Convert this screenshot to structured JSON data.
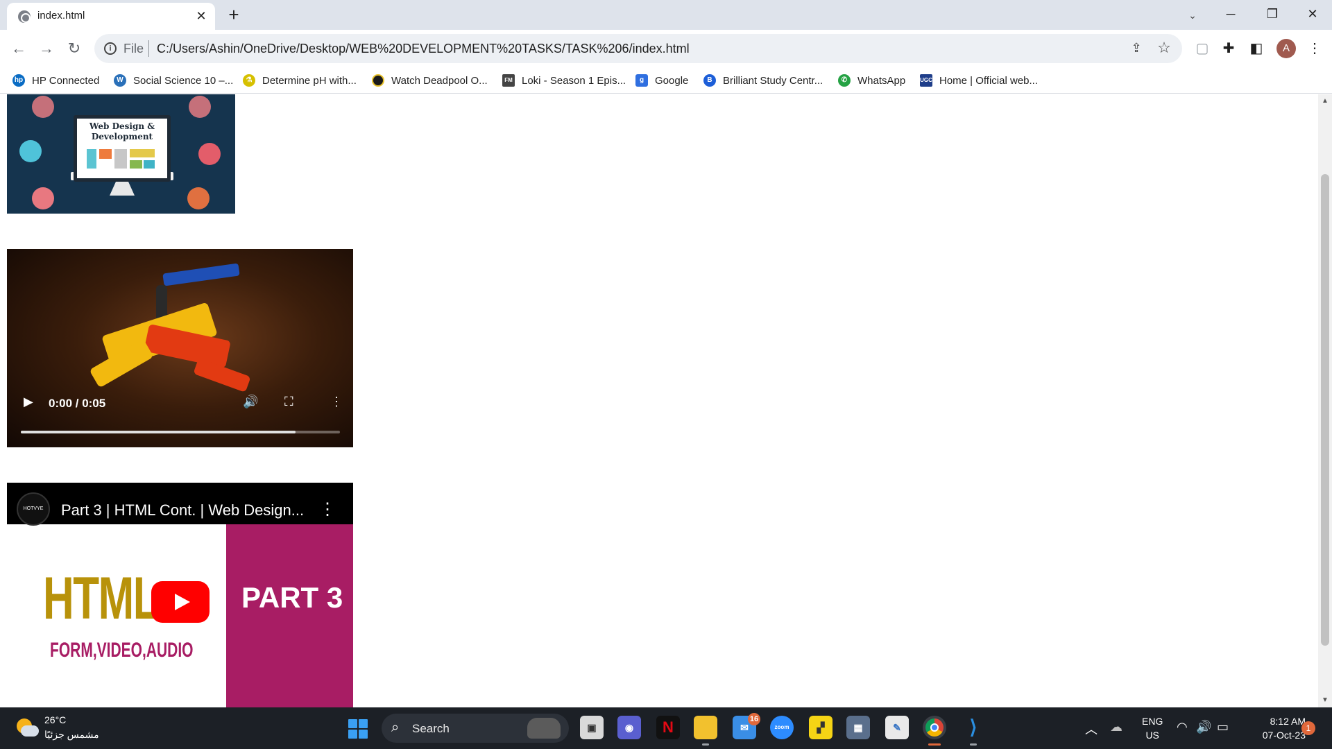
{
  "tab": {
    "title": "index.html",
    "close": "✕",
    "new": "+"
  },
  "window": {
    "minimize": "─",
    "restore": "❐",
    "close": "✕",
    "search": "⌄"
  },
  "nav": {
    "back": "←",
    "forward": "→",
    "reload": "↻"
  },
  "omnibox": {
    "scheme": "File",
    "url": "C:/Users/Ashin/OneDrive/Desktop/WEB%20DEVELOPMENT%20TASKS/TASK%206/index.html"
  },
  "profile": {
    "initial": "A"
  },
  "bookmarks": [
    {
      "label": "HP Connected",
      "icon": "hp-icon",
      "color": "#0a6cc4"
    },
    {
      "label": "Social Science 10 –...",
      "icon": "wordpress-icon",
      "color": "#2a70b9"
    },
    {
      "label": "Determine pH with...",
      "icon": "flask-icon",
      "color": "#d6c000"
    },
    {
      "label": "Watch Deadpool O...",
      "icon": "film-icon",
      "color": "#1a1a1a"
    },
    {
      "label": "Loki - Season 1 Epis...",
      "icon": "fmovies-icon",
      "color": "#444444"
    },
    {
      "label": "Google",
      "icon": "google-icon",
      "color": "#2f6fe0"
    },
    {
      "label": "Brilliant Study Centr...",
      "icon": "bsc-icon",
      "color": "#1c5ed8"
    },
    {
      "label": "WhatsApp",
      "icon": "whatsapp-icon",
      "color": "#25a244"
    },
    {
      "label": "Home | Official web...",
      "icon": "ugc-icon",
      "color": "#1f3e8a"
    }
  ],
  "banner": {
    "line1": "Web Design &",
    "line2": "Development"
  },
  "video": {
    "time": "0:00 / 0:05",
    "progress": 0.86,
    "play": "▶",
    "volume": "🔊",
    "fullscreen": "⛶",
    "more": "⋮"
  },
  "youtube": {
    "title": "Part 3 | HTML Cont. | Web Design...",
    "channel": "HOTVYE",
    "thumb_big": "HTML",
    "thumb_sub": "FORM,VIDEO,AUDIO",
    "thumb_part": "PART 3",
    "more": "⋮"
  },
  "taskbar": {
    "temperature": "26°C",
    "condition": "مشمس جزئيًا",
    "search": "Search",
    "mail_badge": "16",
    "lang1": "ENG",
    "lang2": "US",
    "time": "8:12 AM",
    "date": "07-Oct-23",
    "notifications": "1"
  }
}
